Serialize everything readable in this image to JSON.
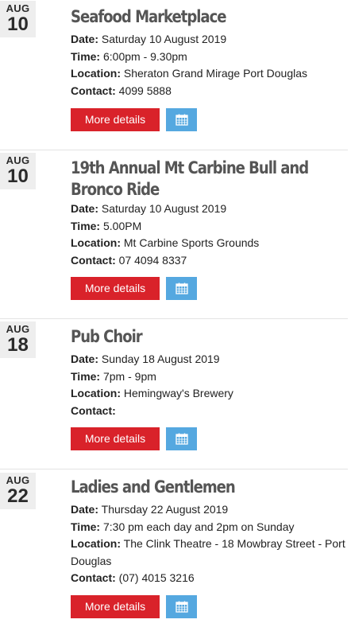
{
  "events": [
    {
      "month": "AUG",
      "day": "10",
      "title": "Seafood Marketplace",
      "date_label": "Date:",
      "date": "Saturday 10 August 2019",
      "time_label": "Time:",
      "time": "6:00pm - 9.30pm",
      "location_label": "Location:",
      "location": "Sheraton Grand Mirage Port Douglas",
      "contact_label": "Contact:",
      "contact": "4099 5888",
      "button_label": "More details"
    },
    {
      "month": "AUG",
      "day": "10",
      "title": "19th Annual Mt Carbine Bull and Bronco Ride",
      "date_label": "Date:",
      "date": "Saturday 10 August 2019",
      "time_label": "Time:",
      "time": "5.00PM",
      "location_label": "Location:",
      "location": "Mt Carbine Sports Grounds",
      "contact_label": "Contact:",
      "contact": "07 4094 8337",
      "button_label": "More details"
    },
    {
      "month": "AUG",
      "day": "18",
      "title": "Pub Choir",
      "date_label": "Date:",
      "date": "Sunday 18 August 2019",
      "time_label": "Time:",
      "time": "7pm - 9pm",
      "location_label": "Location:",
      "location": "Hemingway's Brewery",
      "contact_label": "Contact:",
      "contact": "",
      "button_label": "More details"
    },
    {
      "month": "AUG",
      "day": "22",
      "title": "Ladies and Gentlemen",
      "date_label": "Date:",
      "date": "Thursday 22 August 2019",
      "time_label": "Time:",
      "time": "7:30 pm each day and 2pm on Sunday",
      "location_label": "Location:",
      "location": "The Clink Theatre - 18 Mowbray Street - Port Douglas",
      "contact_label": "Contact:",
      "contact": "(07) 4015 3216",
      "button_label": "More details"
    }
  ],
  "icons": {
    "calendar": "calendar-icon"
  },
  "colors": {
    "primary_button": "#d9222a",
    "calendar_button": "#55a8e0",
    "title_text": "#555555",
    "date_badge_bg": "#eeeeee"
  }
}
